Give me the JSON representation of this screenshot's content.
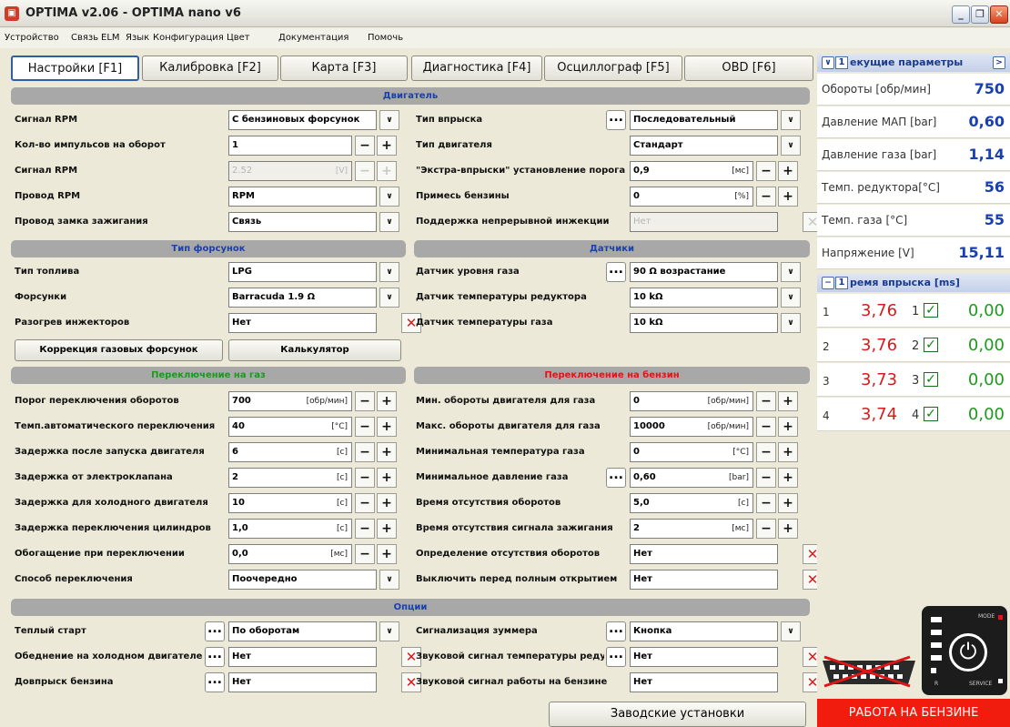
{
  "window": {
    "title": "OPTIMA v2.06  -  OPTIMA nano v6"
  },
  "menu": [
    "Устройство",
    "Связь",
    "ELM",
    "Язык",
    "Конфигурация",
    "Цвет",
    "Документация",
    "Помочь"
  ],
  "tabs": [
    "Настройки [F1]",
    "Калибровка [F2]",
    "Карта [F3]",
    "Диагностика [F4]",
    "Осциллограф [F5]",
    "OBD [F6]"
  ],
  "engine": {
    "header": "Двигатель",
    "left": [
      {
        "label": "Сигнал RPM",
        "value": "С бензиновых форсунок",
        "control": "dropdown"
      },
      {
        "label": "Кол-во импульсов на оборот",
        "value": "1",
        "control": "stepper"
      },
      {
        "label": "Сигнал RPM",
        "value": "2.52",
        "unit": "[V]",
        "control": "stepper",
        "disabled": true
      },
      {
        "label": "Провод RPM",
        "value": "RPM",
        "control": "dropdown"
      },
      {
        "label": "Провод замка зажигания",
        "value": "Связь",
        "control": "dropdown"
      }
    ],
    "right": [
      {
        "label": "Тип впрыска",
        "value": "Последовательный",
        "control": "dropdown",
        "dots": true
      },
      {
        "label": "Тип двигателя",
        "value": "Стандарт",
        "control": "dropdown"
      },
      {
        "label": "\"Экстра-впрыски\" установление порога",
        "value": "0,9",
        "unit": "[мс]",
        "control": "stepper"
      },
      {
        "label": "Примесь бензины",
        "value": "0",
        "unit": "[%]",
        "control": "stepper"
      },
      {
        "label": "Поддержка непрерывной инжекции",
        "value": "Нет",
        "control": "clear",
        "disabled": true
      }
    ]
  },
  "injectors": {
    "header": "Тип форсунок",
    "rows": [
      {
        "label": "Тип топлива",
        "value": "LPG",
        "control": "dropdown"
      },
      {
        "label": "Форсунки",
        "value": "Barracuda 1.9 Ω",
        "control": "dropdown"
      },
      {
        "label": "Разогрев инжекторов",
        "value": "Нет",
        "control": "clear"
      }
    ],
    "buttons": [
      "Коррекция газовых форсунок",
      "Калькулятор"
    ]
  },
  "sensors": {
    "header": "Датчики",
    "rows": [
      {
        "label": "Датчик уровня газа",
        "value": "90 Ω возрастание",
        "control": "dropdown",
        "dots": true
      },
      {
        "label": "Датчик температуры редуктора",
        "value": "10 kΩ",
        "control": "dropdown"
      },
      {
        "label": "Датчик температуры газа",
        "value": "10 kΩ",
        "control": "dropdown"
      }
    ]
  },
  "switch_gas": {
    "header": "Переключение на газ",
    "rows": [
      {
        "label": "Порог переключения оборотов",
        "value": "700",
        "unit": "[обр/мин]",
        "control": "stepper"
      },
      {
        "label": "Темп.автоматического переключения",
        "value": "40",
        "unit": "[°C]",
        "control": "stepper"
      },
      {
        "label": "Задержка после запуска двигателя",
        "value": "6",
        "unit": "[c]",
        "control": "stepper"
      },
      {
        "label": "Задержка от электроклапана",
        "value": "2",
        "unit": "[c]",
        "control": "stepper"
      },
      {
        "label": "Задержка для холодного двигателя",
        "value": "10",
        "unit": "[c]",
        "control": "stepper"
      },
      {
        "label": "Задержка переключения цилиндров",
        "value": "1,0",
        "unit": "[c]",
        "control": "stepper"
      },
      {
        "label": "Обогащение при переключении",
        "value": "0,0",
        "unit": "[мс]",
        "control": "stepper"
      },
      {
        "label": "Способ переключения",
        "value": "Поочередно",
        "control": "dropdown"
      }
    ]
  },
  "switch_petrol": {
    "header": "Переключение на бензин",
    "rows": [
      {
        "label": "Мин. обороты двигателя для газа",
        "value": "0",
        "unit": "[обр/мин]",
        "control": "stepper"
      },
      {
        "label": "Макс. обороты двигателя для газа",
        "value": "10000",
        "unit": "[обр/мин]",
        "control": "stepper"
      },
      {
        "label": "Минимальная температура газа",
        "value": "0",
        "unit": "[°C]",
        "control": "stepper"
      },
      {
        "label": "Минимальное давление газа",
        "value": "0,60",
        "unit": "[bar]",
        "control": "stepper",
        "dots": true
      },
      {
        "label": "Время отсутствия оборотов",
        "value": "5,0",
        "unit": "[c]",
        "control": "stepper"
      },
      {
        "label": "Время отсутствия сигнала зажигания",
        "value": "2",
        "unit": "[мс]",
        "control": "stepper"
      },
      {
        "label": "Определение отсутствия оборотов",
        "value": "Нет",
        "control": "clear"
      },
      {
        "label": "Выключить перед полным открытием",
        "value": "Нет",
        "control": "clear"
      }
    ]
  },
  "options": {
    "header": "Опции",
    "left": [
      {
        "label": "Теплый старт",
        "value": "По оборотам",
        "control": "dropdown",
        "dots": true
      },
      {
        "label": "Обеднение на холодном двигателе",
        "value": "Нет",
        "control": "clear",
        "dots": true
      },
      {
        "label": "Довпрыск бензина",
        "value": "Нет",
        "control": "clear",
        "dots": true
      }
    ],
    "right": [
      {
        "label": "Сигнализация зуммера",
        "value": "Кнопка",
        "control": "dropdown",
        "dots": true
      },
      {
        "label": "Звуковой сигнал температуры редуктора",
        "value": "Нет",
        "control": "clear",
        "dots": true
      },
      {
        "label": "Звуковой сигнал работы на бензине",
        "value": "Нет",
        "control": "clear"
      }
    ]
  },
  "factory_button": "Заводские установки",
  "params_panel": {
    "header": "екущие параметры",
    "header_num": "1",
    "rows": [
      {
        "label": "Обороты  [обр/мин]",
        "value": "750"
      },
      {
        "label": "Давление МАП [bar]",
        "value": "0,60"
      },
      {
        "label": "Давление газа [bar]",
        "value": "1,14"
      },
      {
        "label": "Темп. редуктора[°C]",
        "value": "56"
      },
      {
        "label": "Темп. газа        [°C]",
        "value": "55"
      },
      {
        "label": "Напряжение      [V]",
        "value": "15,11"
      }
    ]
  },
  "injection_panel": {
    "header": "ремя впрыска [ms]",
    "header_num": "1",
    "rows": [
      {
        "idx": "1",
        "petrol": "3,76",
        "cyl": "1",
        "gas": "0,00"
      },
      {
        "idx": "2",
        "petrol": "3,76",
        "cyl": "2",
        "gas": "0,00"
      },
      {
        "idx": "3",
        "petrol": "3,73",
        "cyl": "3",
        "gas": "0,00"
      },
      {
        "idx": "4",
        "petrol": "3,74",
        "cyl": "4",
        "gas": "0,00"
      }
    ]
  },
  "device": {
    "mode_label": "MODE",
    "service_label": "SERVICE",
    "r_label": "R"
  },
  "status": "РАБОТА НА БЕНЗИНЕ"
}
